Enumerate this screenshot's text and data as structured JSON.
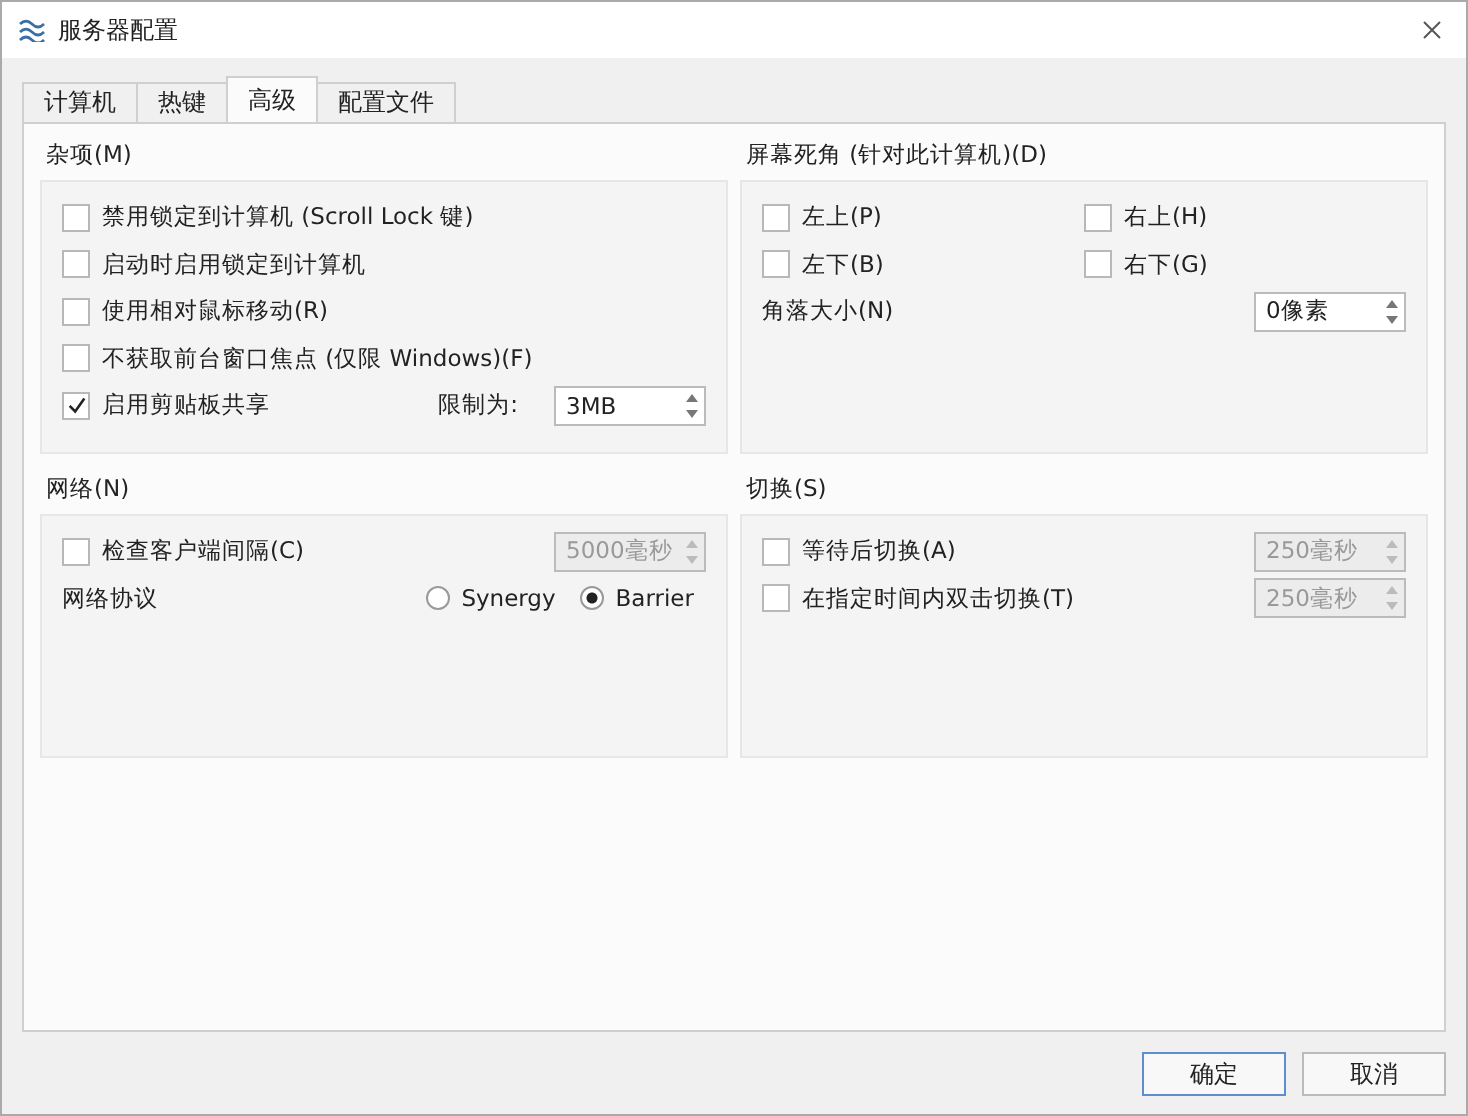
{
  "window": {
    "title": "服务器配置"
  },
  "tabs": [
    {
      "label": "计算机",
      "selected": false
    },
    {
      "label": "热键",
      "selected": false
    },
    {
      "label": "高级",
      "selected": true
    },
    {
      "label": "配置文件",
      "selected": false
    }
  ],
  "misc": {
    "title": "杂项(M)",
    "options": [
      {
        "label": "禁用锁定到计算机 (Scroll Lock 键)",
        "checked": false
      },
      {
        "label": "启动时启用锁定到计算机",
        "checked": false
      },
      {
        "label": "使用相对鼠标移动(R)",
        "checked": false
      },
      {
        "label": "不获取前台窗口焦点 (仅限 Windows)(F)",
        "checked": false
      },
      {
        "label": "启用剪贴板共享",
        "checked": true,
        "limit_label": "限制为:",
        "limit_value": "3MB"
      }
    ]
  },
  "dead_corners": {
    "title": "屏幕死角 (针对此计算机)(D)",
    "corners": [
      {
        "label": "左上(P)",
        "checked": false
      },
      {
        "label": "右上(H)",
        "checked": false
      },
      {
        "label": "左下(B)",
        "checked": false
      },
      {
        "label": "右下(G)",
        "checked": false
      }
    ],
    "size_label": "角落大小(N)",
    "size_value": "0像素"
  },
  "network": {
    "title": "网络(N)",
    "heartbeat": {
      "label": "检查客户端间隔(C)",
      "checked": false,
      "value": "5000毫秒",
      "disabled": true
    },
    "protocol_label": "网络协议",
    "protocols": [
      {
        "label": "Synergy",
        "selected": false
      },
      {
        "label": "Barrier",
        "selected": true
      }
    ]
  },
  "switching": {
    "title": "切换(S)",
    "options": [
      {
        "label": "等待后切换(A)",
        "checked": false,
        "value": "250毫秒",
        "disabled": true
      },
      {
        "label": "在指定时间内双击切换(T)",
        "checked": false,
        "value": "250毫秒",
        "disabled": true
      }
    ]
  },
  "buttons": [
    {
      "label": "确定",
      "default": true
    },
    {
      "label": "取消",
      "default": false
    }
  ]
}
